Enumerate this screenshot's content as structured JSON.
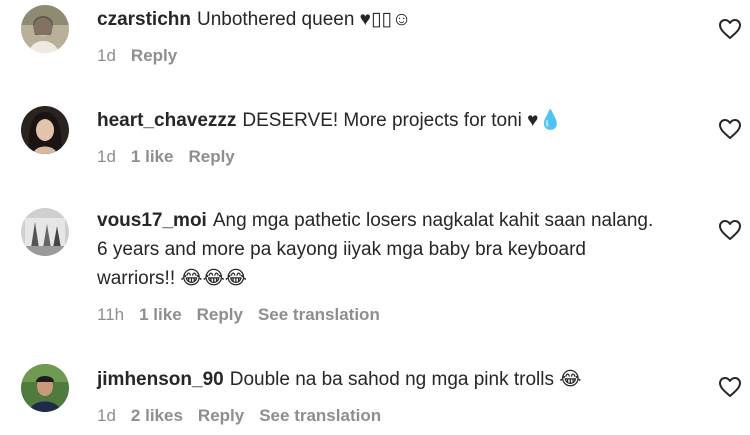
{
  "comments": [
    {
      "username": "czarstichn",
      "text": "Unbothered queen ♥︎▯▯☺",
      "time": "1d",
      "likes": "",
      "reply": "Reply",
      "translation": ""
    },
    {
      "username": "heart_chavezzz",
      "text": "DESERVE! More projects for toni ♥💧",
      "time": "1d",
      "likes": "1 like",
      "reply": "Reply",
      "translation": ""
    },
    {
      "username": "vous17_moi",
      "text": "Ang mga pathetic losers nagkalat kahit saan nalang. 6 years and more pa kayong iiyak mga baby bra keyboard warriors!! 😂😂😂",
      "time": "11h",
      "likes": "1 like",
      "reply": "Reply",
      "translation": "See translation"
    },
    {
      "username": "jimhenson_90",
      "text": "Double na ba sahod ng mga pink trolls 😂",
      "time": "1d",
      "likes": "2 likes",
      "reply": "Reply",
      "translation": "See translation"
    }
  ],
  "icons": {
    "like": "heart-outline-icon"
  },
  "colors": {
    "text": "#262626",
    "meta": "#8e8e8e",
    "background": "#ffffff"
  }
}
